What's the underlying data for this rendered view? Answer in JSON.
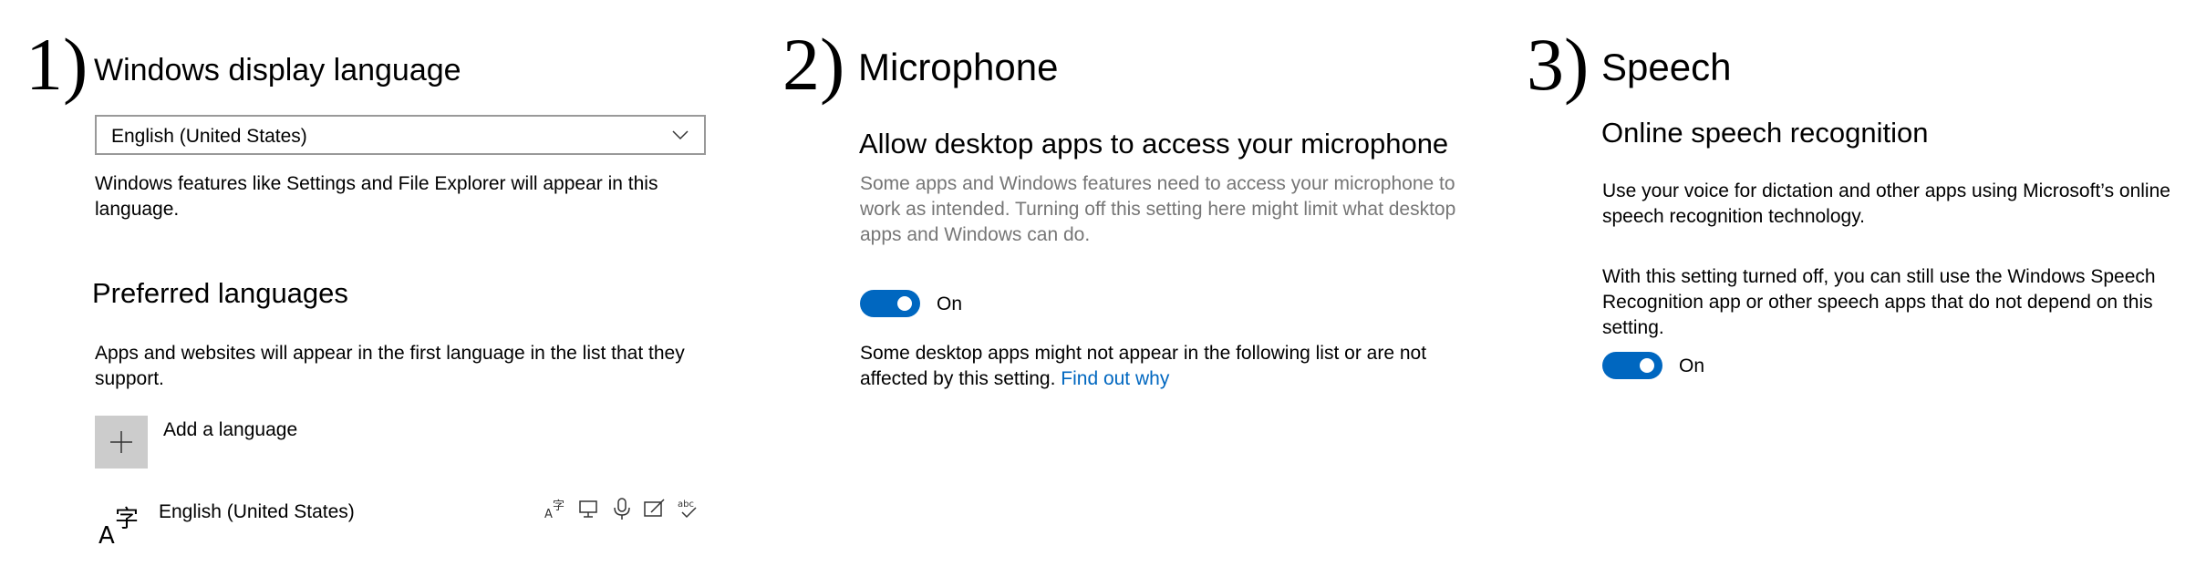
{
  "panel1": {
    "number": "1)",
    "title": "Windows display language",
    "dropdown_value": "English (United States)",
    "description": "Windows features like Settings and File Explorer will appear in this language.",
    "preferred_title": "Preferred languages",
    "preferred_description": "Apps and websites will appear in the first language in the list that they support.",
    "add_language_label": "Add a language",
    "language_item": "English (United States)",
    "language_feature_icons": [
      "language-pack-icon",
      "display-icon",
      "microphone-icon",
      "handwriting-icon",
      "spellcheck-icon"
    ]
  },
  "panel2": {
    "number": "2)",
    "title": "Microphone",
    "subtitle": "Allow desktop apps to access your microphone",
    "description": "Some apps and Windows features need to access your microphone to work as intended. Turning off this setting here might limit what desktop apps and Windows can do.",
    "toggle_state": "On",
    "note_text": "Some desktop apps might not appear in the following list or are not affected by this setting.",
    "note_link": "Find out why"
  },
  "panel3": {
    "number": "3)",
    "title": "Speech",
    "subtitle": "Online speech recognition",
    "description1": "Use your voice for dictation and other apps using Microsoft’s online speech recognition technology.",
    "description2": "With this setting turned off, you can still use the Windows Speech Recognition app or other speech apps that do not depend on this setting.",
    "toggle_state": "On"
  },
  "colors": {
    "accent": "#0067c0",
    "muted_text": "#767676",
    "add_button_bg": "#cccccc"
  }
}
